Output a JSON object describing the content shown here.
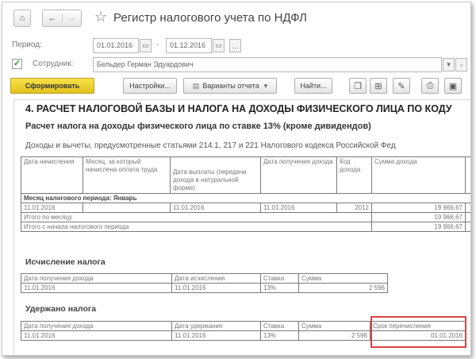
{
  "window": {
    "title": "Регистр налогового учета по НДФЛ"
  },
  "form": {
    "period_label": "Период:",
    "date_from": "01.01.2016",
    "date_sep": "-",
    "date_to": "01.12.2016",
    "employee_label": "Сотрудник:",
    "employee_value": "Бельдер Герман Эдуардович",
    "employee_checked": true
  },
  "toolbar": {
    "generate": "Сформировать",
    "settings": "Настройки...",
    "report_variants": "Варианты отчета",
    "find": "Найти..."
  },
  "report": {
    "section_title": "4. РАСЧЕТ НАЛОГОВОЙ БАЗЫ И НАЛОГА НА ДОХОДЫ ФИЗИЧЕСКОГО ЛИЦА ПО КОДУ",
    "subtitle": "Расчет налога на доходы физического лица по ставке 13% (кроме дивидендов)",
    "income_text": "Доходы и вычеты, предусмотренные статьями 214.1, 217 и 221 Налогового кодекса Российской Фед",
    "income_table": {
      "headers": [
        "Дата начисления",
        "Месяц, за который начислена оплата труда",
        "Дата выплаты (передачи дохода в натуральной форме)",
        "Дата получения дохода",
        "Код дохода",
        "Сумма дохода"
      ],
      "month_row": "Месяц налогового периода: Январь",
      "row": [
        "11.01.2016",
        "",
        "11.01.2016",
        "11.01.2016",
        "2012",
        "19 966,67"
      ],
      "total_month_label": "Итого по месяцу",
      "total_month_value": "19 966,67",
      "total_period_label": "Итого с начала налогового периода",
      "total_period_value": "19 966,67"
    },
    "calc_title": "Исчисление налога",
    "calc_table": {
      "headers": [
        "Дата получения дохода",
        "Дата исчисления",
        "Ставка",
        "Сумма"
      ],
      "row": [
        "11.01.2016",
        "11.01.2016",
        "13%",
        "2 596"
      ]
    },
    "withheld_title": "Удержано налога",
    "withheld_table": {
      "headers": [
        "Дата получения дохода",
        "Дата удержания",
        "Ставка",
        "Сумма",
        "Срок перечисления"
      ],
      "row": [
        "11.01.2016",
        "11.01.2016",
        "13%",
        "2 596",
        "01.01.2016"
      ]
    }
  },
  "colors": {
    "accent_yellow": "#f0d030",
    "highlight_red": "#d64545"
  },
  "icons": {
    "home": "home-icon",
    "back": "arrow-left-icon",
    "forward": "arrow-right-icon",
    "favorite": "star-icon",
    "calendar": "calendar-icon",
    "dropdown": "chevron-down-icon",
    "print": "printer-icon",
    "save": "save-icon"
  }
}
